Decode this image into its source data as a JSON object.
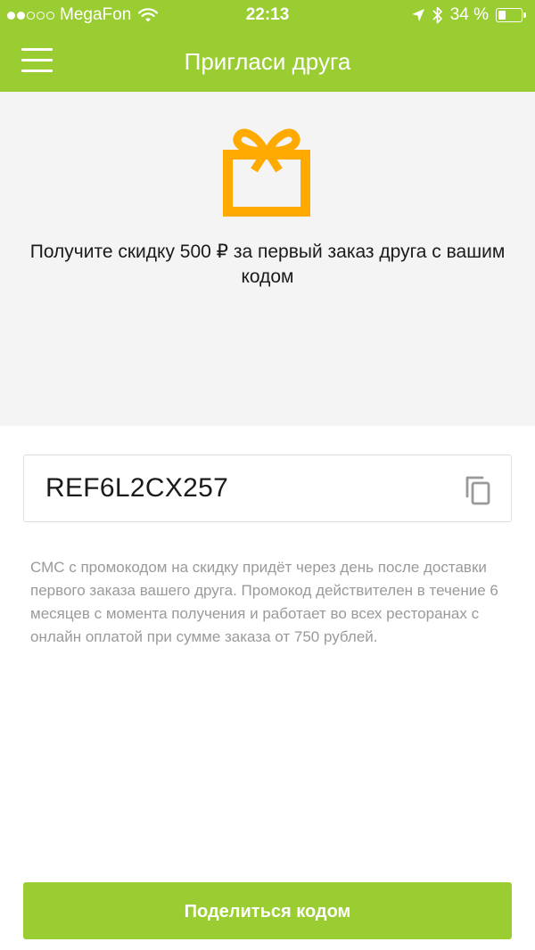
{
  "status_bar": {
    "carrier": "MegaFon",
    "time": "22:13",
    "battery": "34 %",
    "battery_level": 0.34,
    "signal_bars_filled": 2,
    "signal_bars_total": 5
  },
  "nav": {
    "title": "Пригласи друга",
    "menu_icon": "hamburger-menu-icon"
  },
  "promo": {
    "icon": "gift-icon",
    "text": "Получите скидку 500 ₽ за первый заказ друга с вашим кодом"
  },
  "code": {
    "value": "REF6L2CX257",
    "copy_icon": "copy-icon"
  },
  "note": "СМС с промокодом на скидку придёт через день после доставки первого заказа вашего друга. Промокод действителен в течение 6 месяцев с момента получения и работает во всех ресторанах с онлайн оплатой при сумме заказа от 750 рублей.",
  "share_button": {
    "label": "Поделиться кодом"
  },
  "colors": {
    "accent": "#9acd32",
    "gift": "#ffaa00",
    "promo_background": "#f4f4f4",
    "note_text": "#9a9a9a"
  }
}
